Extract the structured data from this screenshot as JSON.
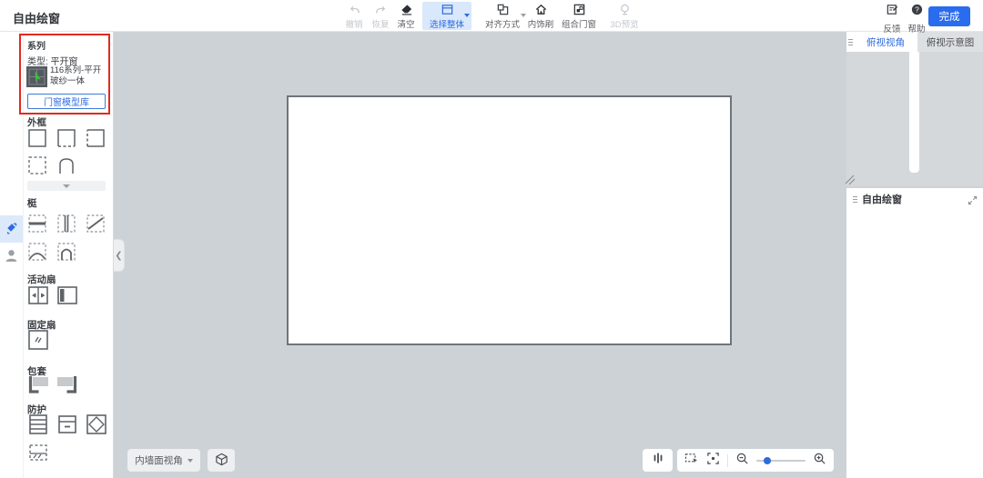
{
  "app": {
    "title": "自由绘窗"
  },
  "toolbar": {
    "undo": "撤销",
    "redo": "恢复",
    "clear": "清空",
    "select_whole": "选择整体",
    "align": "对齐方式",
    "inner_brush": "内饰刷",
    "combine_window": "组合门窗",
    "preview_3d": "3D预览",
    "feedback": "反馈",
    "help": "帮助",
    "finish": "完成"
  },
  "series": {
    "title": "系列",
    "type": "类型: 平开窗",
    "model": "116系列-平开玻纱一体",
    "library_button": "门窗模型库"
  },
  "palette": {
    "outer_frame": "外框",
    "mullion": "梃",
    "active_sash": "活动扇",
    "fixed_sash": "固定扇",
    "casing": "包套",
    "guard": "防护"
  },
  "canvas_controls": {
    "wall_view": "内墙面视角"
  },
  "right_panel": {
    "tab_top_view": "俯视视角",
    "tab_top_schematic": "俯视示意图",
    "bottom_title": "自由绘窗"
  },
  "colors": {
    "accent_blue": "#2e6be0",
    "finish_button": "#2a6cee",
    "series_highlight_red": "#e12a20",
    "canvas_gray": "#cdd2d6"
  }
}
